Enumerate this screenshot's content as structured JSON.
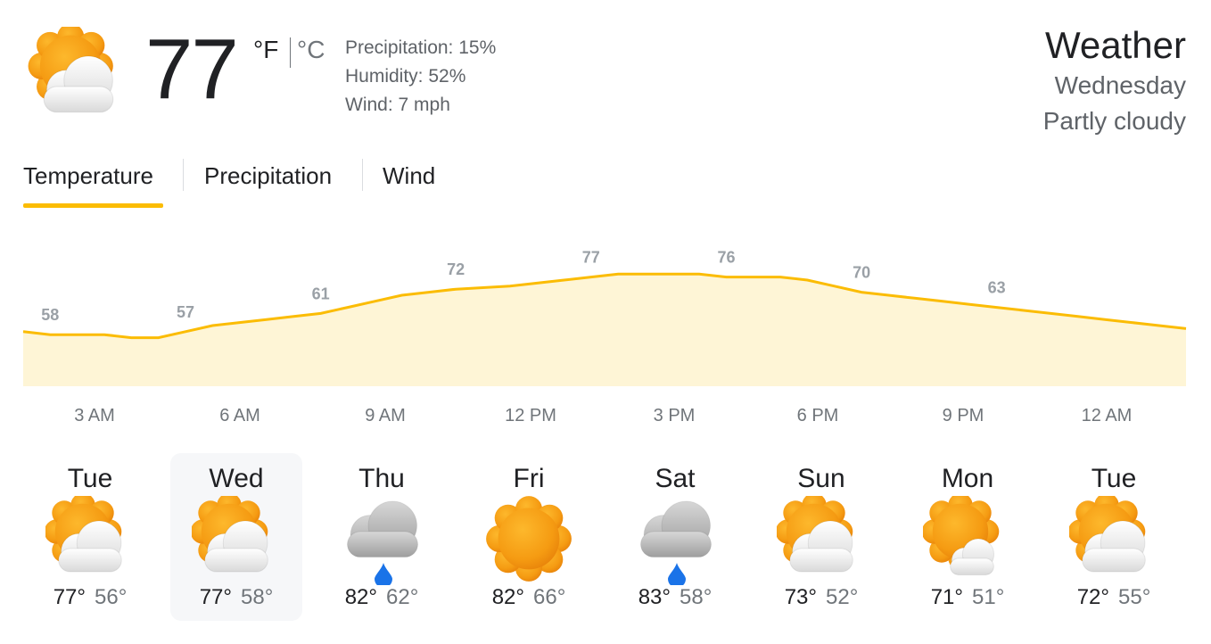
{
  "current": {
    "icon": "partly-cloudy-icon",
    "temperature": "77",
    "unit_f": "°F",
    "unit_c": "°C",
    "precipitation": "Precipitation: 15%",
    "humidity": "Humidity: 52%",
    "wind": "Wind: 7 mph"
  },
  "header": {
    "title": "Weather",
    "day": "Wednesday",
    "condition": "Partly cloudy"
  },
  "tabs": [
    {
      "label": "Temperature",
      "selected": true
    },
    {
      "label": "Precipitation",
      "selected": false
    },
    {
      "label": "Wind",
      "selected": false
    }
  ],
  "colors": {
    "accent": "#fbbc04",
    "area_fill": "#fef5d6",
    "value_label": "#9aa0a6",
    "rain_drop": "#1a73e8"
  },
  "chart_data": {
    "type": "area",
    "series": [
      {
        "values": [
          58,
          57,
          57,
          57,
          56,
          56,
          58,
          60,
          61,
          62,
          63,
          64,
          66,
          68,
          70,
          71,
          72,
          72.5,
          73,
          74,
          75,
          76,
          77,
          77,
          77,
          77,
          76,
          76,
          76,
          75,
          73,
          71,
          70,
          69,
          68,
          67,
          66,
          65,
          64,
          63,
          62,
          61,
          60,
          59
        ]
      }
    ],
    "value_labels": [
      {
        "index": 1,
        "text": "58"
      },
      {
        "index": 6,
        "text": "57"
      },
      {
        "index": 11,
        "text": "61"
      },
      {
        "index": 16,
        "text": "72"
      },
      {
        "index": 21,
        "text": "77"
      },
      {
        "index": 26,
        "text": "76"
      },
      {
        "index": 31,
        "text": "70"
      },
      {
        "index": 36,
        "text": "63"
      }
    ],
    "x_tick_labels": [
      "3 AM",
      "6 AM",
      "9 AM",
      "12 PM",
      "3 PM",
      "6 PM",
      "9 PM",
      "12 AM"
    ],
    "ylim": [
      40,
      85
    ]
  },
  "forecast": [
    {
      "day": "Tue",
      "icon": "partly-cloudy-icon",
      "high": "77°",
      "low": "56°",
      "selected": false
    },
    {
      "day": "Wed",
      "icon": "partly-cloudy-icon",
      "high": "77°",
      "low": "58°",
      "selected": true
    },
    {
      "day": "Thu",
      "icon": "rain-icon",
      "high": "82°",
      "low": "62°",
      "selected": false
    },
    {
      "day": "Fri",
      "icon": "sunny-icon",
      "high": "82°",
      "low": "66°",
      "selected": false
    },
    {
      "day": "Sat",
      "icon": "rain-icon",
      "high": "83°",
      "low": "58°",
      "selected": false
    },
    {
      "day": "Sun",
      "icon": "partly-cloudy-icon",
      "high": "73°",
      "low": "52°",
      "selected": false
    },
    {
      "day": "Mon",
      "icon": "mostly-sunny-icon",
      "high": "71°",
      "low": "51°",
      "selected": false
    },
    {
      "day": "Tue",
      "icon": "partly-cloudy-icon",
      "high": "72°",
      "low": "55°",
      "selected": false
    }
  ]
}
